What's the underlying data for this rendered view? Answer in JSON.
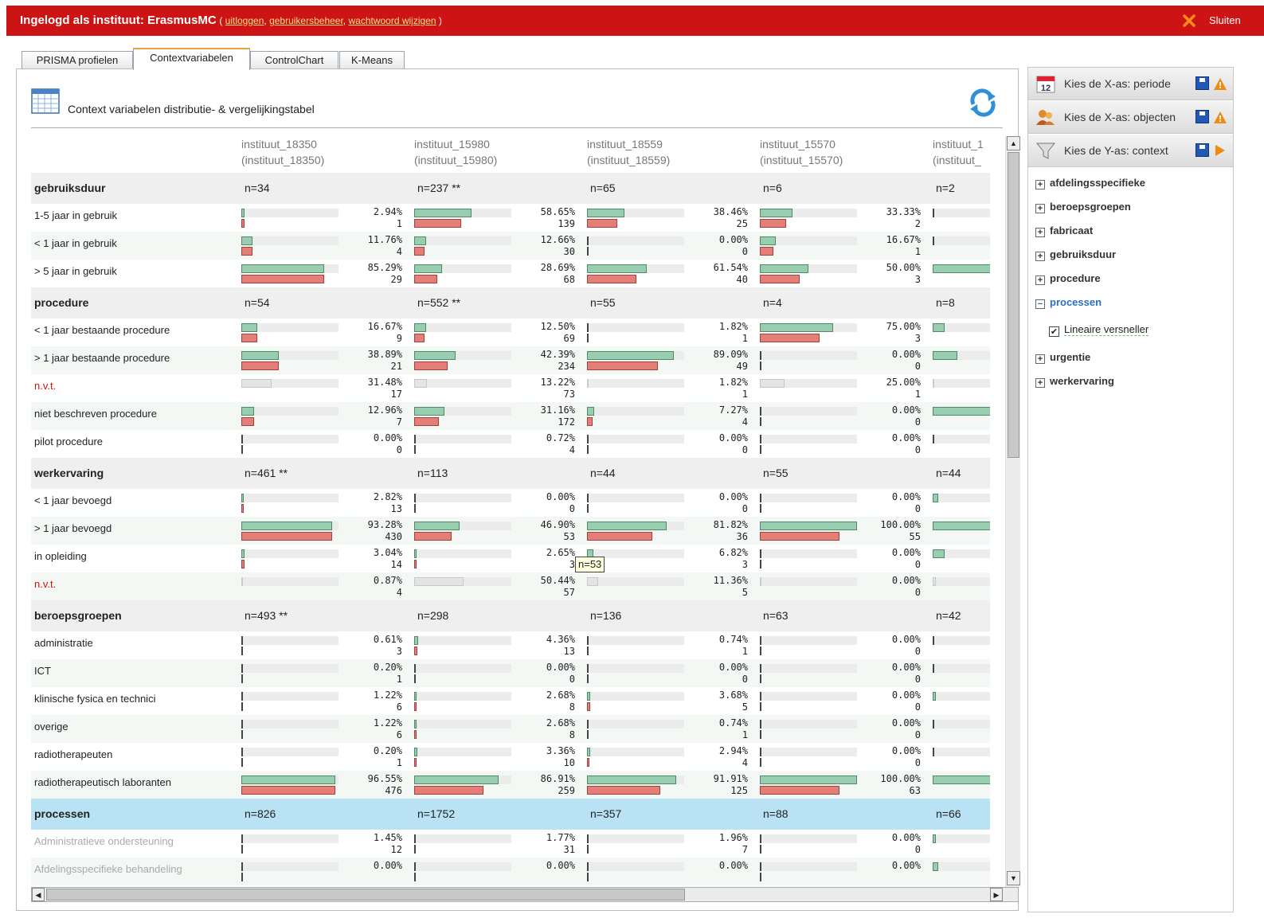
{
  "header": {
    "title": "Ingelogd als instituut: ErasmusMC",
    "link_open": "(",
    "links": [
      "uitloggen",
      "gebruikersbeheer",
      "wachtwoord wijzigen"
    ],
    "link_sep": ",",
    "link_close": ")",
    "close_label": "Sluiten"
  },
  "tabs": [
    "PRISMA profielen",
    "Contextvariabelen",
    "ControlChart",
    "K-Means"
  ],
  "active_tab": 1,
  "panel": {
    "title": "Context variabelen distributie- & vergelijkingstabel"
  },
  "columns": [
    {
      "name": "instituut_18350",
      "sub": "(instituut_18350)"
    },
    {
      "name": "instituut_15980",
      "sub": "(instituut_15980)"
    },
    {
      "name": "instituut_18559",
      "sub": "(instituut_18559)"
    },
    {
      "name": "instituut_15570",
      "sub": "(instituut_15570)"
    },
    {
      "name": "instituut_1",
      "sub": "(instituut_"
    }
  ],
  "sections": [
    {
      "title": "gebruiksduur",
      "n": [
        "n=34",
        "n=237 **",
        "n=65",
        "n=6",
        "n=2"
      ],
      "rows": [
        {
          "label": "1-5 jaar in gebruik",
          "cells": [
            [
              0.0294,
              "2.94%",
              "1"
            ],
            [
              0.5865,
              "58.65%",
              "139"
            ],
            [
              0.3846,
              "38.46%",
              "25"
            ],
            [
              0.3333,
              "33.33%",
              "2"
            ],
            [
              0,
              "",
              ""
            ]
          ]
        },
        {
          "label": "< 1 jaar in gebruik",
          "cells": [
            [
              0.1176,
              "11.76%",
              "4"
            ],
            [
              0.1266,
              "12.66%",
              "30"
            ],
            [
              0,
              "0.00%",
              "0"
            ],
            [
              0.1667,
              "16.67%",
              "1"
            ],
            [
              0,
              "",
              ""
            ]
          ]
        },
        {
          "label": "> 5 jaar in gebruik",
          "cells": [
            [
              0.8529,
              "85.29%",
              "29"
            ],
            [
              0.2869,
              "28.69%",
              "68"
            ],
            [
              0.6154,
              "61.54%",
              "40"
            ],
            [
              0.5,
              "50.00%",
              "3"
            ],
            [
              1,
              "",
              ""
            ]
          ]
        }
      ]
    },
    {
      "title": "procedure",
      "n": [
        "n=54",
        "n=552 **",
        "n=55",
        "n=4",
        "n=8"
      ],
      "rows": [
        {
          "label": "< 1 jaar bestaande procedure",
          "cells": [
            [
              0.1667,
              "16.67%",
              "9"
            ],
            [
              0.125,
              "12.50%",
              "69"
            ],
            [
              0.0182,
              "1.82%",
              "1"
            ],
            [
              0.75,
              "75.00%",
              "3"
            ],
            [
              0.125,
              "",
              ""
            ]
          ]
        },
        {
          "label": "> 1 jaar bestaande procedure",
          "cells": [
            [
              0.3889,
              "38.89%",
              "21"
            ],
            [
              0.4239,
              "42.39%",
              "234"
            ],
            [
              0.8909,
              "89.09%",
              "49"
            ],
            [
              0,
              "0.00%",
              "0"
            ],
            [
              0.25,
              "",
              ""
            ]
          ]
        },
        {
          "label": "n.v.t.",
          "red": true,
          "gray": true,
          "cells": [
            [
              0.3148,
              "31.48%",
              "17"
            ],
            [
              0.1322,
              "13.22%",
              "73"
            ],
            [
              0.0182,
              "1.82%",
              "1"
            ],
            [
              0.25,
              "25.00%",
              "1"
            ],
            [
              0,
              "",
              ""
            ]
          ]
        },
        {
          "label": "niet beschreven procedure",
          "cells": [
            [
              0.1296,
              "12.96%",
              "7"
            ],
            [
              0.3116,
              "31.16%",
              "172"
            ],
            [
              0.0727,
              "7.27%",
              "4"
            ],
            [
              0,
              "0.00%",
              "0"
            ],
            [
              0.625,
              "",
              ""
            ]
          ]
        },
        {
          "label": "pilot procedure",
          "cells": [
            [
              0,
              "0.00%",
              "0"
            ],
            [
              0.0072,
              "0.72%",
              "4"
            ],
            [
              0,
              "0.00%",
              "0"
            ],
            [
              0,
              "0.00%",
              "0"
            ],
            [
              0,
              "",
              ""
            ]
          ]
        }
      ]
    },
    {
      "title": "werkervaring",
      "n": [
        "n=461 **",
        "n=113",
        "n=44",
        "n=55",
        "n=44"
      ],
      "rows": [
        {
          "label": "< 1 jaar bevoegd",
          "cells": [
            [
              0.0282,
              "2.82%",
              "13"
            ],
            [
              0,
              "0.00%",
              "0"
            ],
            [
              0,
              "0.00%",
              "0"
            ],
            [
              0,
              "0.00%",
              "0"
            ],
            [
              0.06,
              "",
              ""
            ]
          ]
        },
        {
          "label": "> 1 jaar bevoegd",
          "cells": [
            [
              0.9328,
              "93.28%",
              "430"
            ],
            [
              0.469,
              "46.90%",
              "53"
            ],
            [
              0.8182,
              "81.82%",
              "36"
            ],
            [
              1,
              "100.00%",
              "55"
            ],
            [
              0.8,
              "",
              ""
            ]
          ]
        },
        {
          "label": "in opleiding",
          "cells": [
            [
              0.0304,
              "3.04%",
              "14"
            ],
            [
              0.0265,
              "2.65%",
              "3"
            ],
            [
              0.0682,
              "6.82%",
              "3"
            ],
            [
              0,
              "0.00%",
              "0"
            ],
            [
              0.12,
              "",
              ""
            ]
          ]
        },
        {
          "label": "n.v.t.",
          "red": true,
          "gray": true,
          "cells": [
            [
              0.0087,
              "0.87%",
              "4"
            ],
            [
              0.5044,
              "50.44%",
              "57"
            ],
            [
              0.1136,
              "11.36%",
              "5"
            ],
            [
              0,
              "0.00%",
              "0"
            ],
            [
              0.03,
              "",
              ""
            ]
          ]
        }
      ]
    },
    {
      "title": "beroepsgroepen",
      "n": [
        "n=493 **",
        "n=298",
        "n=136",
        "n=63",
        "n=42"
      ],
      "rows": [
        {
          "label": "administratie",
          "cells": [
            [
              0.0061,
              "0.61%",
              "3"
            ],
            [
              0.0436,
              "4.36%",
              "13"
            ],
            [
              0.0074,
              "0.74%",
              "1"
            ],
            [
              0,
              "0.00%",
              "0"
            ],
            [
              0,
              "",
              ""
            ]
          ]
        },
        {
          "label": "ICT",
          "cells": [
            [
              0.002,
              "0.20%",
              "1"
            ],
            [
              0,
              "0.00%",
              "0"
            ],
            [
              0,
              "0.00%",
              "0"
            ],
            [
              0,
              "0.00%",
              "0"
            ],
            [
              0,
              "",
              ""
            ]
          ]
        },
        {
          "label": "klinische fysica en technici",
          "cells": [
            [
              0.0122,
              "1.22%",
              "6"
            ],
            [
              0.0268,
              "2.68%",
              "8"
            ],
            [
              0.0368,
              "3.68%",
              "5"
            ],
            [
              0,
              "0.00%",
              "0"
            ],
            [
              0.03,
              "",
              ""
            ]
          ]
        },
        {
          "label": "overige",
          "cells": [
            [
              0.0122,
              "1.22%",
              "6"
            ],
            [
              0.0268,
              "2.68%",
              "8"
            ],
            [
              0.0074,
              "0.74%",
              "1"
            ],
            [
              0,
              "0.00%",
              "0"
            ],
            [
              0,
              "",
              ""
            ]
          ]
        },
        {
          "label": "radiotherapeuten",
          "cells": [
            [
              0.002,
              "0.20%",
              "1"
            ],
            [
              0.0336,
              "3.36%",
              "10"
            ],
            [
              0.0294,
              "2.94%",
              "4"
            ],
            [
              0,
              "0.00%",
              "0"
            ],
            [
              0.02,
              "",
              ""
            ]
          ]
        },
        {
          "label": "radiotherapeutisch laboranten",
          "cells": [
            [
              0.9655,
              "96.55%",
              "476"
            ],
            [
              0.8691,
              "86.91%",
              "259"
            ],
            [
              0.9191,
              "91.91%",
              "125"
            ],
            [
              1,
              "100.00%",
              "63"
            ],
            [
              0.9,
              "",
              ""
            ]
          ]
        }
      ]
    },
    {
      "title": "processen",
      "highlight": true,
      "n": [
        "n=826",
        "n=1752",
        "n=357",
        "n=88",
        "n=66"
      ],
      "rows": [
        {
          "label": "Administratieve ondersteuning",
          "dim": true,
          "cells": [
            [
              0.0145,
              "1.45%",
              "12"
            ],
            [
              0.0177,
              "1.77%",
              "31"
            ],
            [
              0.0196,
              "1.96%",
              "7"
            ],
            [
              0,
              "0.00%",
              "0"
            ],
            [
              0.03,
              "",
              ""
            ]
          ]
        },
        {
          "label": "Afdelingsspecifieke behandeling",
          "dim": true,
          "cells": [
            [
              0,
              "0.00%",
              ""
            ],
            [
              0,
              "0.00%",
              ""
            ],
            [
              0,
              "0.00%",
              ""
            ],
            [
              0,
              "0.00%",
              ""
            ],
            [
              0.06,
              "",
              ""
            ]
          ]
        }
      ]
    }
  ],
  "tooltip": "n=53",
  "sidebar": {
    "heads": [
      {
        "label": "Kies de X-as: periode",
        "icon": "calendar-icon",
        "arrow": "warning-icon"
      },
      {
        "label": "Kies de X-as: objecten",
        "icon": "users-icon",
        "arrow": "warning-icon"
      },
      {
        "label": "Kies de Y-as: context",
        "icon": "filter-icon",
        "arrow": "play-icon"
      }
    ],
    "tree": [
      {
        "label": "afdelingsspecifieke",
        "open": false
      },
      {
        "label": "beroepsgroepen",
        "open": false
      },
      {
        "label": "fabricaat",
        "open": false
      },
      {
        "label": "gebruiksduur",
        "open": false
      },
      {
        "label": "procedure",
        "open": false
      },
      {
        "label": "processen",
        "open": true
      },
      {
        "label": "urgentie",
        "open": false
      },
      {
        "label": "werkervaring",
        "open": false
      }
    ],
    "checkbox_label": "Lineaire versneller",
    "checkbox_checked": true
  },
  "colors": {
    "header_red": "#cc1414",
    "green_bar": "#98cdb0",
    "red_bar": "#e47f78",
    "highlight": "#b9e3f4",
    "link": "#2a6fc4"
  }
}
